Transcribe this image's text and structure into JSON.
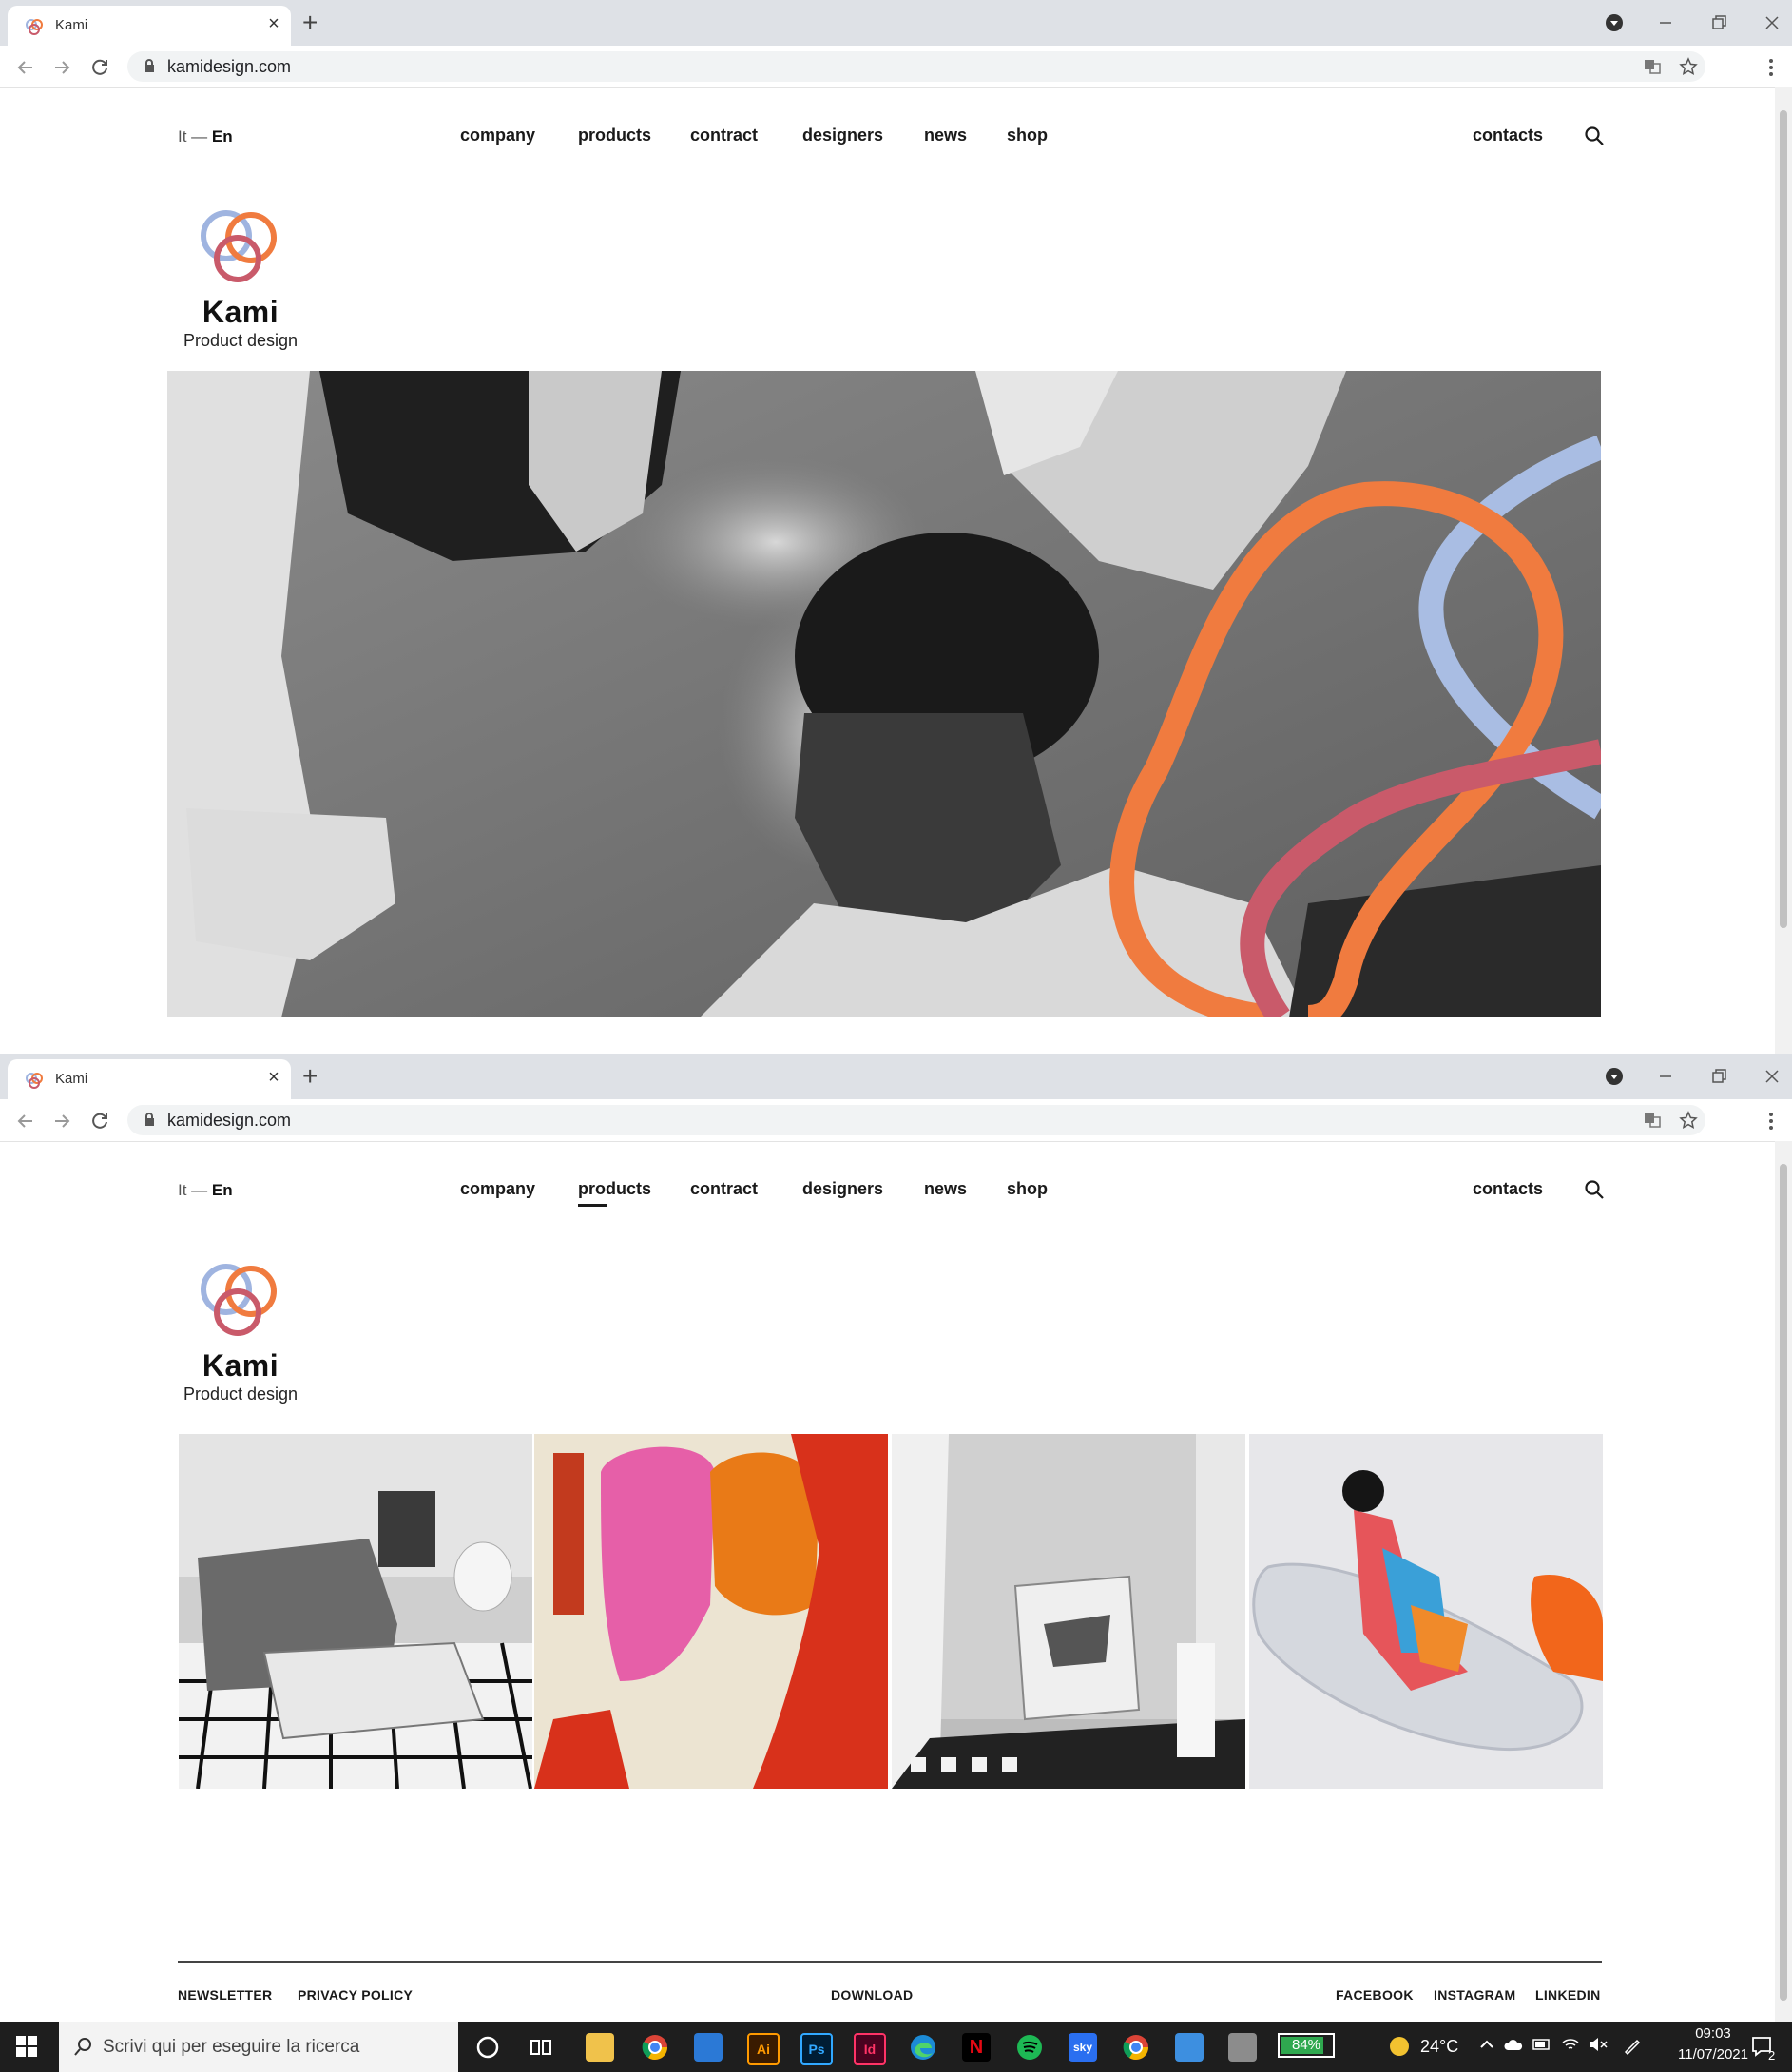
{
  "browser": {
    "tab_title": "Kami",
    "url": "kamidesign.com",
    "new_tab_label": "+",
    "close_tab_label": "×"
  },
  "site": {
    "lang_it": "It",
    "lang_sep": " — ",
    "lang_en": "En",
    "menu": [
      "company",
      "products",
      "contract",
      "designers",
      "news",
      "shop"
    ],
    "contacts": "contacts",
    "logo_name": "Kami",
    "logo_sub": "Product design",
    "active_menu_second_view": "products"
  },
  "footer": {
    "newsletter": "NEWSLETTER",
    "privacy": "PRIVACY POLICY",
    "download": "DOWNLOAD",
    "facebook": "FACEBOOK",
    "instagram": "INSTAGRAM",
    "linkedin": "LINKEDIN"
  },
  "taskbar": {
    "search_placeholder": "Scrivi qui per eseguire la ricerca",
    "battery": "84%",
    "battery_level": 0.84,
    "temperature": "24°C",
    "time": "09:03",
    "date": "11/07/2021",
    "notifications": "2",
    "app_icons": [
      "cortana-icon",
      "task-view-icon",
      "file-explorer-icon",
      "chrome-icon",
      "mail-icon",
      "illustrator-icon",
      "photoshop-icon",
      "indesign-icon",
      "edge-icon",
      "netflix-icon",
      "spotify-icon",
      "sky-icon",
      "chrome-active-icon",
      "photos-icon",
      "printer-icon"
    ],
    "app_labels": {
      "illustrator": "Ai",
      "photoshop": "Ps",
      "indesign": "Id",
      "netflix": "N",
      "sky": "sky"
    }
  },
  "colors": {
    "logo_orange": "#f07b3f",
    "logo_blue": "#9fb4e0",
    "logo_red": "#c95a6a",
    "taskbar": "#1e1e1e"
  }
}
